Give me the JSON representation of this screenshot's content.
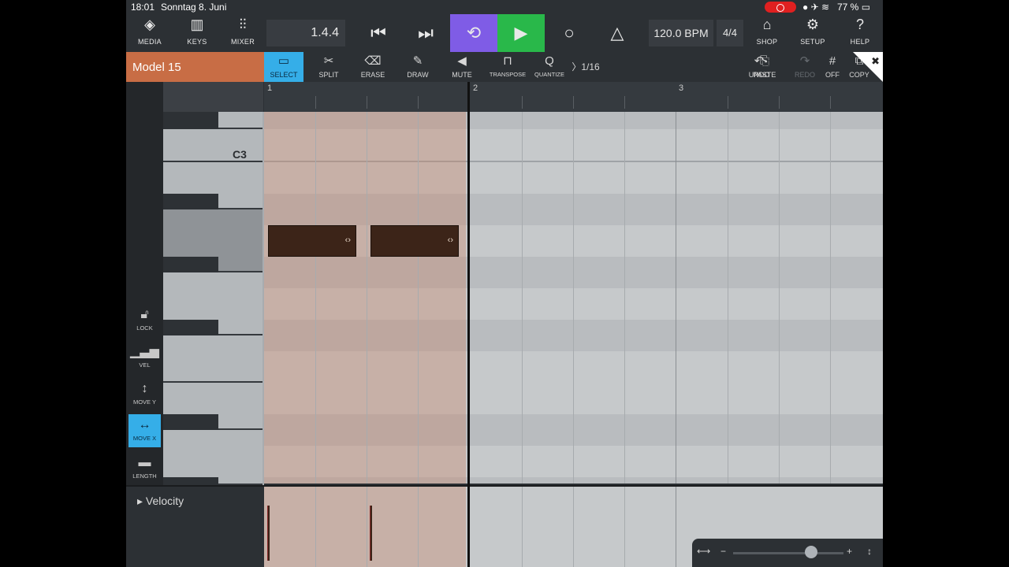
{
  "status_bar": {
    "time": "18:01",
    "date": "Sonntag 8. Juni",
    "battery": "77 %"
  },
  "top_bar": {
    "media": "MEDIA",
    "keys": "KEYS",
    "mixer": "MIXER",
    "position": "1.4.4",
    "tempo": "120.0 BPM",
    "time_signature": "4/4",
    "shop": "SHOP",
    "setup": "SETUP",
    "help": "HELP"
  },
  "track": {
    "name": "Model 15"
  },
  "toolbar": {
    "select": "SELECT",
    "split": "SPLIT",
    "erase": "ERASE",
    "draw": "DRAW",
    "mute": "MUTE",
    "transpose": "TRANSPOSE",
    "quantize": "QUANTIZE",
    "quantize_value": "1/16",
    "undo": "UNDO",
    "redo": "REDO",
    "copy": "COPY",
    "paste": "PASTE",
    "grid": "OFF"
  },
  "edit_modes": {
    "lock": "LOCK",
    "vel": "VEL",
    "move_y": "MOVE Y",
    "move_x": "MOVE X",
    "length": "LENGTH"
  },
  "piano": {
    "c3_label": "C3"
  },
  "ruler": {
    "bar1": "1",
    "bar2": "2",
    "bar3": "3"
  },
  "velocity_lane": {
    "label": "Velocity"
  },
  "colors": {
    "accent": "#35aee8",
    "loop": "#7f5ce6",
    "play": "#29b84a",
    "track": "#c86d45",
    "note": "#3c2418"
  }
}
